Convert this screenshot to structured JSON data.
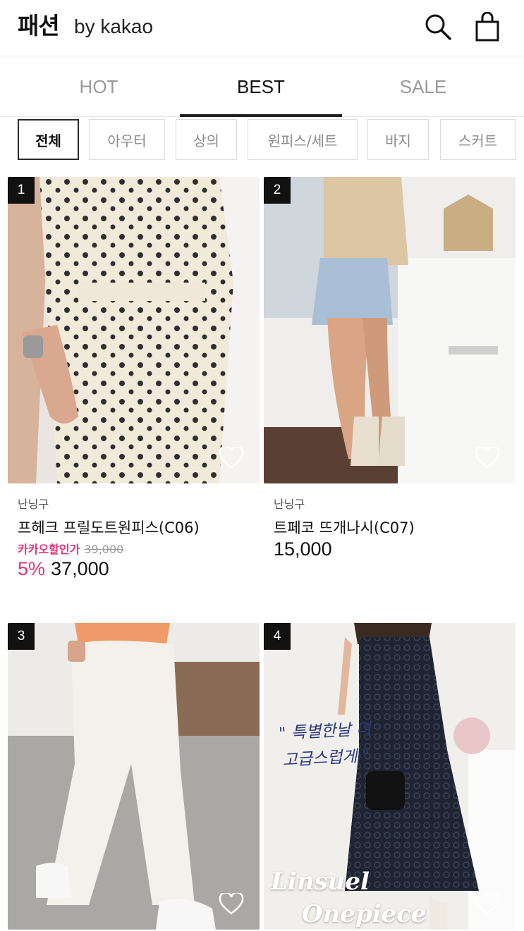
{
  "header": {
    "logo_main": "패션",
    "logo_sub": "by kakao",
    "icons": [
      "search-icon",
      "shopping-bag-icon"
    ]
  },
  "tabs": [
    {
      "label": "HOT",
      "active": false
    },
    {
      "label": "BEST",
      "active": true
    },
    {
      "label": "SALE",
      "active": false
    }
  ],
  "categories": [
    {
      "label": "전체",
      "active": true
    },
    {
      "label": "아우터",
      "active": false
    },
    {
      "label": "상의",
      "active": false
    },
    {
      "label": "원피스/세트",
      "active": false
    },
    {
      "label": "바지",
      "active": false
    },
    {
      "label": "스커트",
      "active": false
    }
  ],
  "products": [
    {
      "rank": "1",
      "brand": "난닝구",
      "name": "프헤크 프릴도트원피스(C06)",
      "promo_label": "카카오할인가",
      "original_price": "39,000",
      "discount": "5%",
      "price": "37,000"
    },
    {
      "rank": "2",
      "brand": "난닝구",
      "name": "트페코 뜨개나시(C07)",
      "price": "15,000"
    },
    {
      "rank": "3"
    },
    {
      "rank": "4",
      "photo_text_line1": "\" 특별한날 더",
      "photo_text_line2": "고급스럽게 \"",
      "photo_title_line1": "Linsuel",
      "photo_title_line2": "Onepiece"
    }
  ],
  "colors": {
    "accent_pink": "#e0357a",
    "text_dark": "#111111",
    "text_muted": "#9a9a9a"
  }
}
